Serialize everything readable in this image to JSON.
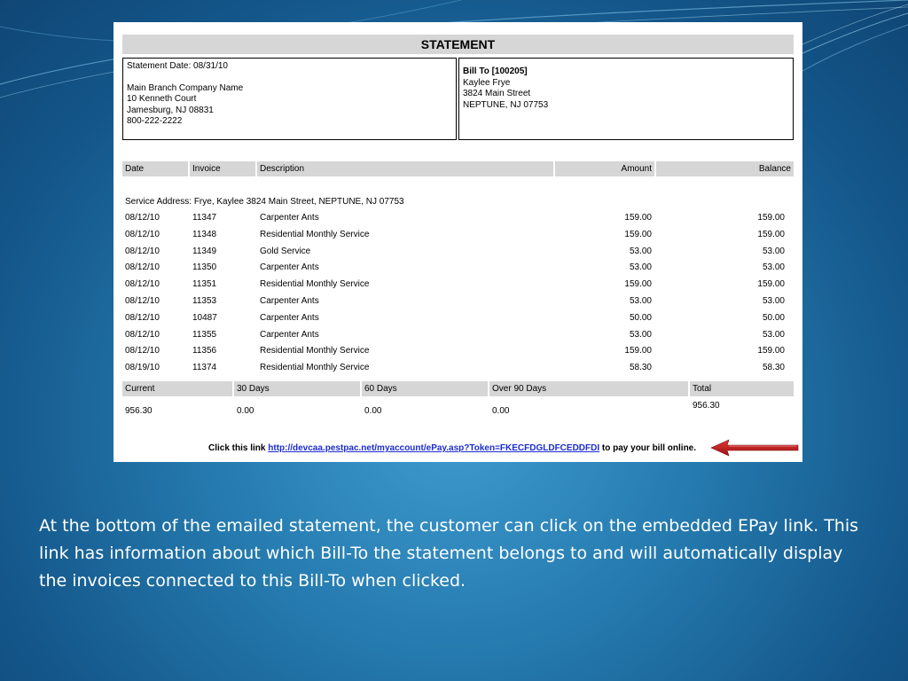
{
  "statement": {
    "title": "STATEMENT",
    "from": {
      "statement_date": "Statement Date: 08/31/10",
      "company": "Main Branch Company Name",
      "street": "10 Kenneth Court",
      "city": "Jamesburg, NJ 08831",
      "phone": "800-222-2222"
    },
    "bill_to": {
      "heading": "Bill To [100205]",
      "name": "Kaylee Frye",
      "street": "3824 Main Street",
      "city": "NEPTUNE, NJ 07753"
    },
    "columns": {
      "date": "Date",
      "invoice": "Invoice",
      "description": "Description",
      "amount": "Amount",
      "balance": "Balance"
    },
    "service_address": "Service Address: Frye, Kaylee 3824 Main Street, NEPTUNE, NJ 07753",
    "rows": [
      {
        "date": "08/12/10",
        "invoice": "11347",
        "description": "Carpenter Ants",
        "amount": "159.00",
        "balance": "159.00"
      },
      {
        "date": "08/12/10",
        "invoice": "11348",
        "description": "Residential Monthly Service",
        "amount": "159.00",
        "balance": "159.00"
      },
      {
        "date": "08/12/10",
        "invoice": "11349",
        "description": "Gold Service",
        "amount": "53.00",
        "balance": "53.00"
      },
      {
        "date": "08/12/10",
        "invoice": "11350",
        "description": "Carpenter Ants",
        "amount": "53.00",
        "balance": "53.00"
      },
      {
        "date": "08/12/10",
        "invoice": "11351",
        "description": "Residential Monthly Service",
        "amount": "159.00",
        "balance": "159.00"
      },
      {
        "date": "08/12/10",
        "invoice": "11353",
        "description": "Carpenter Ants",
        "amount": "53.00",
        "balance": "53.00"
      },
      {
        "date": "08/12/10",
        "invoice": "10487",
        "description": "Carpenter Ants",
        "amount": "50.00",
        "balance": "50.00"
      },
      {
        "date": "08/12/10",
        "invoice": "11355",
        "description": "Carpenter Ants",
        "amount": "53.00",
        "balance": "53.00"
      },
      {
        "date": "08/12/10",
        "invoice": "11356",
        "description": "Residential Monthly Service",
        "amount": "159.00",
        "balance": "159.00"
      },
      {
        "date": "08/19/10",
        "invoice": "11374",
        "description": "Residential Monthly Service",
        "amount": "58.30",
        "balance": "58.30"
      }
    ],
    "aging": {
      "current_label": "Current",
      "current_value": "956.30",
      "d30_label": "30 Days",
      "d30_value": "0.00",
      "d60_label": "60 Days",
      "d60_value": "0.00",
      "d90_label": "Over 90 Days",
      "d90_value": "0.00",
      "total_label": "Total",
      "total_value": "956.30"
    },
    "footer": {
      "prefix": "Click this link ",
      "link_text": "http://devcaa.pestpac.net/myaccount/ePay.asp?Token=FKECFDGLDFCEDDFDI",
      "suffix": " to pay your bill online."
    }
  },
  "caption": "At the bottom of the emailed statement, the customer can click on the embedded EPay link.  This link has information about which Bill-To the statement belongs to and will automatically display the invoices connected to this Bill-To when clicked.",
  "colors": {
    "arrow": "#c21e1e",
    "link": "#1a2ccf",
    "header_gray": "#d6d6d6"
  }
}
